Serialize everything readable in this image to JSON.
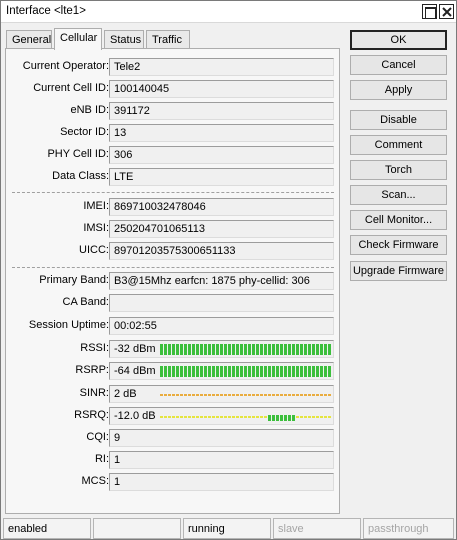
{
  "window": {
    "title": "Interface <lte1>"
  },
  "tabs": [
    "General",
    "Cellular",
    "Status",
    "Traffic"
  ],
  "fields": {
    "current_operator": {
      "label": "Current Operator:",
      "value": "Tele2"
    },
    "current_cell_id": {
      "label": "Current Cell ID:",
      "value": "100140045"
    },
    "enb_id": {
      "label": "eNB ID:",
      "value": "391172"
    },
    "sector_id": {
      "label": "Sector ID:",
      "value": "13"
    },
    "phy_cell_id": {
      "label": "PHY Cell ID:",
      "value": "306"
    },
    "data_class": {
      "label": "Data Class:",
      "value": "LTE"
    },
    "imei": {
      "label": "IMEI:",
      "value": "869710032478046"
    },
    "imsi": {
      "label": "IMSI:",
      "value": "250204701065113"
    },
    "uicc": {
      "label": "UICC:",
      "value": "89701203575300651133"
    },
    "primary_band": {
      "label": "Primary Band:",
      "value": "B3@15Mhz earfcn: 1875 phy-cellid: 306"
    },
    "ca_band": {
      "label": "CA Band:",
      "value": ""
    },
    "session_uptime": {
      "label": "Session Uptime:",
      "value": "00:02:55"
    },
    "cqi": {
      "label": "CQI:",
      "value": "9"
    },
    "ri": {
      "label": "RI:",
      "value": "1"
    },
    "mcs": {
      "label": "MCS:",
      "value": "1"
    }
  },
  "signal": {
    "rssi": {
      "label": "RSSI:",
      "value": "-32 dBm",
      "level": 1.0,
      "color": "#3cbf3c"
    },
    "rsrp": {
      "label": "RSRP:",
      "value": "-64 dBm",
      "level": 1.0,
      "color": "#3cbf3c"
    },
    "sinr": {
      "label": "SINR:",
      "value": "2 dB",
      "level": 0.0,
      "color": "#e8a020"
    },
    "rsrq": {
      "label": "RSRQ:",
      "value": "-12.0 dB",
      "level": 0.0,
      "color": "#e3e320",
      "highlight_color": "#3cbf3c"
    }
  },
  "buttons": [
    "OK",
    "Cancel",
    "Apply",
    "Disable",
    "Comment",
    "Torch",
    "Scan...",
    "Cell Monitor...",
    "Check Firmware",
    "Upgrade Firmware"
  ],
  "status_bar": [
    "enabled",
    "",
    "running",
    "slave",
    "passthrough"
  ]
}
